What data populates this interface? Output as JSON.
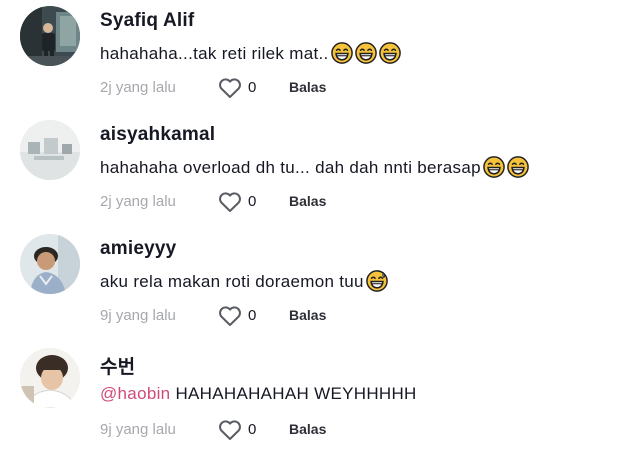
{
  "comments": [
    {
      "username": "Syafiq Alif",
      "text": "hahahaha...tak reti rilek mat..",
      "emojis": [
        "grinning-sweat-face",
        "grinning-sweat-face",
        "grinning-sweat-face"
      ],
      "time": "2j yang lalu",
      "likes": "0",
      "reply": "Balas"
    },
    {
      "username": "aisyahkamal",
      "text": "hahahaha overload dh tu... dah dah nnti berasap",
      "emojis": [
        "grinning-sweat-face",
        "grinning-sweat-face"
      ],
      "time": "2j yang lalu",
      "likes": "0",
      "reply": "Balas"
    },
    {
      "username": "amieyyy",
      "text": "aku rela makan roti doraemon tuu",
      "emojis": [
        "grinning-sweat-face"
      ],
      "time": "9j yang lalu",
      "likes": "0",
      "reply": "Balas"
    },
    {
      "username": "수번",
      "mention": "@haobin",
      "text": " HAHAHAHAHAH WEYHHHHH",
      "emojis": [],
      "time": "9j yang lalu",
      "likes": "0",
      "reply": "Balas"
    }
  ],
  "icons": {
    "like": "heart-outline-icon"
  },
  "colors": {
    "mention": "#d1497a",
    "meta": "#a6a8ad",
    "text": "#161823"
  }
}
